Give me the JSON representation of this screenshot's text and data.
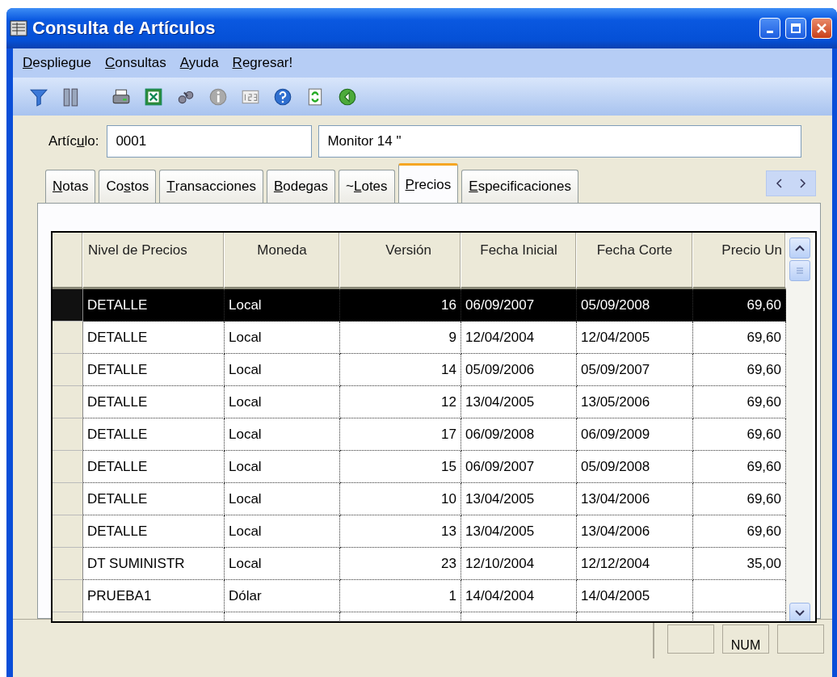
{
  "window": {
    "title": "Consulta de Artículos"
  },
  "menu": [
    {
      "key": "D",
      "rest": "espliegue"
    },
    {
      "key": "C",
      "rest": "onsultas"
    },
    {
      "key": "A",
      "rest": "yuda"
    },
    {
      "key": "R",
      "rest": "egresar!"
    }
  ],
  "toolbar": [
    {
      "kind": "filter"
    },
    {
      "kind": "columns"
    },
    {
      "kind": "sep"
    },
    {
      "kind": "print"
    },
    {
      "kind": "excel"
    },
    {
      "kind": "find"
    },
    {
      "kind": "info"
    },
    {
      "kind": "numbers"
    },
    {
      "kind": "help"
    },
    {
      "kind": "refresh"
    },
    {
      "kind": "back"
    }
  ],
  "article": {
    "label": {
      "lead": "Artíc",
      "key": "u",
      "rest": "lo:"
    },
    "code": "0001",
    "description": "Monitor 14 \""
  },
  "tabs": [
    {
      "key": "N",
      "rest": "otas",
      "selected": false
    },
    {
      "lead": "Co",
      "key": "s",
      "rest": "tos",
      "selected": false
    },
    {
      "key": "T",
      "rest": "ransacciones",
      "selected": false
    },
    {
      "key": "B",
      "rest": "odegas",
      "selected": false
    },
    {
      "lead": "~",
      "key": "L",
      "rest": "otes",
      "selected": false
    },
    {
      "key": "P",
      "rest": "recios",
      "selected": true
    },
    {
      "key": "E",
      "rest": "specificaciones",
      "selected": false
    }
  ],
  "table": {
    "columns": [
      "Nivel de Precios",
      "Moneda",
      "Versión",
      "Fecha Inicial",
      "Fecha Corte",
      "Precio Un"
    ],
    "rows": [
      {
        "cells": [
          "DETALLE",
          "Local",
          "16",
          "06/09/2007",
          "05/09/2008",
          "69,60"
        ],
        "selected": true
      },
      {
        "cells": [
          "DETALLE",
          "Local",
          "9",
          "12/04/2004",
          "12/04/2005",
          "69,60"
        ],
        "selected": false
      },
      {
        "cells": [
          "DETALLE",
          "Local",
          "14",
          "05/09/2006",
          "05/09/2007",
          "69,60"
        ],
        "selected": false
      },
      {
        "cells": [
          "DETALLE",
          "Local",
          "12",
          "13/04/2005",
          "13/05/2006",
          "69,60"
        ],
        "selected": false
      },
      {
        "cells": [
          "DETALLE",
          "Local",
          "17",
          "06/09/2008",
          "06/09/2009",
          "69,60"
        ],
        "selected": false
      },
      {
        "cells": [
          "DETALLE",
          "Local",
          "15",
          "06/09/2007",
          "05/09/2008",
          "69,60"
        ],
        "selected": false
      },
      {
        "cells": [
          "DETALLE",
          "Local",
          "10",
          "13/04/2005",
          "13/04/2006",
          "69,60"
        ],
        "selected": false
      },
      {
        "cells": [
          "DETALLE",
          "Local",
          "13",
          "13/04/2005",
          "13/04/2006",
          "69,60"
        ],
        "selected": false
      },
      {
        "cells": [
          "DT SUMINISTR",
          "Local",
          "23",
          "12/10/2004",
          "12/12/2004",
          "35,00"
        ],
        "selected": false
      },
      {
        "cells": [
          "PRUEBA1",
          "Dólar",
          "1",
          "14/04/2004",
          "14/04/2005"
        ],
        "selected": false
      }
    ]
  },
  "status_bar": {
    "indicator": "NUM"
  }
}
